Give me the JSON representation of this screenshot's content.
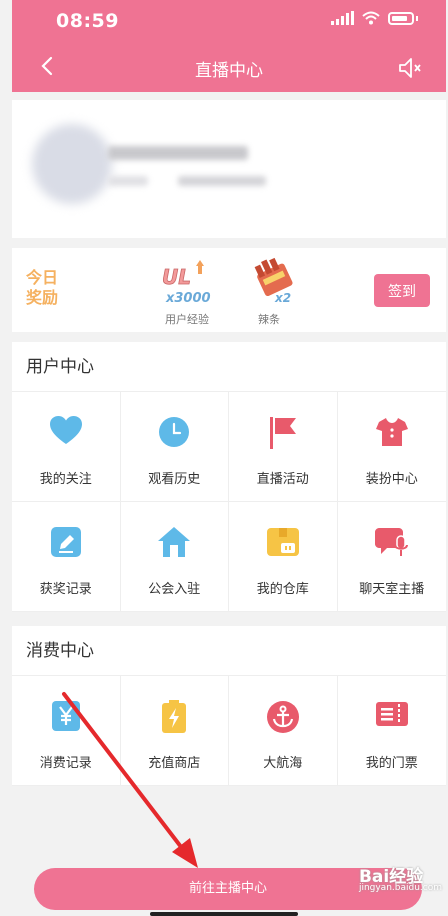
{
  "status": {
    "time": "08:59"
  },
  "header": {
    "title": "直播中心"
  },
  "reward": {
    "badge": "今日\n奖励",
    "items": [
      {
        "art": "UL",
        "mult": "x3000",
        "label": "用户经验"
      },
      {
        "art": "",
        "mult": "x2",
        "label": "辣条"
      }
    ],
    "sign_label": "签到"
  },
  "user_center": {
    "title": "用户中心",
    "items": [
      {
        "label": "我的关注",
        "icon": "heart-icon"
      },
      {
        "label": "观看历史",
        "icon": "clock-icon"
      },
      {
        "label": "直播活动",
        "icon": "flag-icon"
      },
      {
        "label": "装扮中心",
        "icon": "shirt-icon"
      },
      {
        "label": "获奖记录",
        "icon": "edit-icon"
      },
      {
        "label": "公会入驻",
        "icon": "home-icon"
      },
      {
        "label": "我的仓库",
        "icon": "box-icon"
      },
      {
        "label": "聊天室主播",
        "icon": "chat-mic-icon"
      }
    ]
  },
  "consume_center": {
    "title": "消费中心",
    "items": [
      {
        "label": "消费记录",
        "icon": "yen-icon"
      },
      {
        "label": "充值商店",
        "icon": "battery-icon"
      },
      {
        "label": "大航海",
        "icon": "anchor-icon"
      },
      {
        "label": "我的门票",
        "icon": "ticket-icon"
      }
    ]
  },
  "bottom_button": {
    "label": "前往主播中心"
  },
  "watermark": {
    "brand": "Bai经验",
    "url": "jingyan.baidu.com"
  },
  "colors": {
    "accent": "#ef7393",
    "blue": "#5eb9e8",
    "red": "#e85a6b",
    "yellow": "#f6c445"
  }
}
